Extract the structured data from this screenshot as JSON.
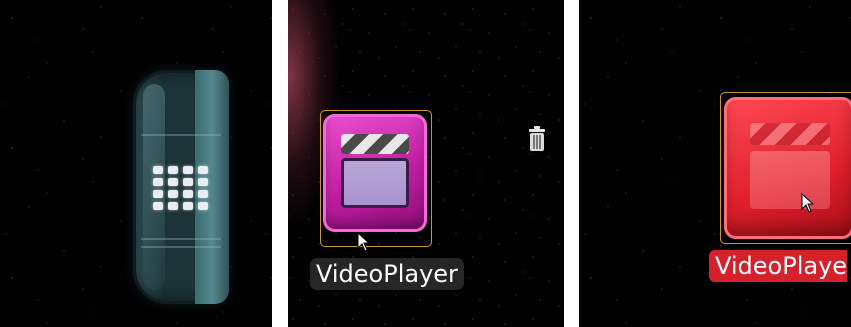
{
  "panels": [
    {
      "id": "launcher",
      "icon": "app-grid-icon",
      "handle_color": "#1c3337"
    },
    {
      "id": "selected",
      "app_label": "VideoPlayer",
      "icon": "clapperboard-icon",
      "icon_color": "#c21ea4",
      "trash_icon": "trash-icon"
    },
    {
      "id": "dragging",
      "app_label": "VideoPlaye",
      "icon": "clapperboard-icon",
      "icon_color": "#e01f2c",
      "label_bg": "#d4212b"
    }
  ],
  "colors": {
    "background": "#020203",
    "selection_border": "#c8962a"
  }
}
